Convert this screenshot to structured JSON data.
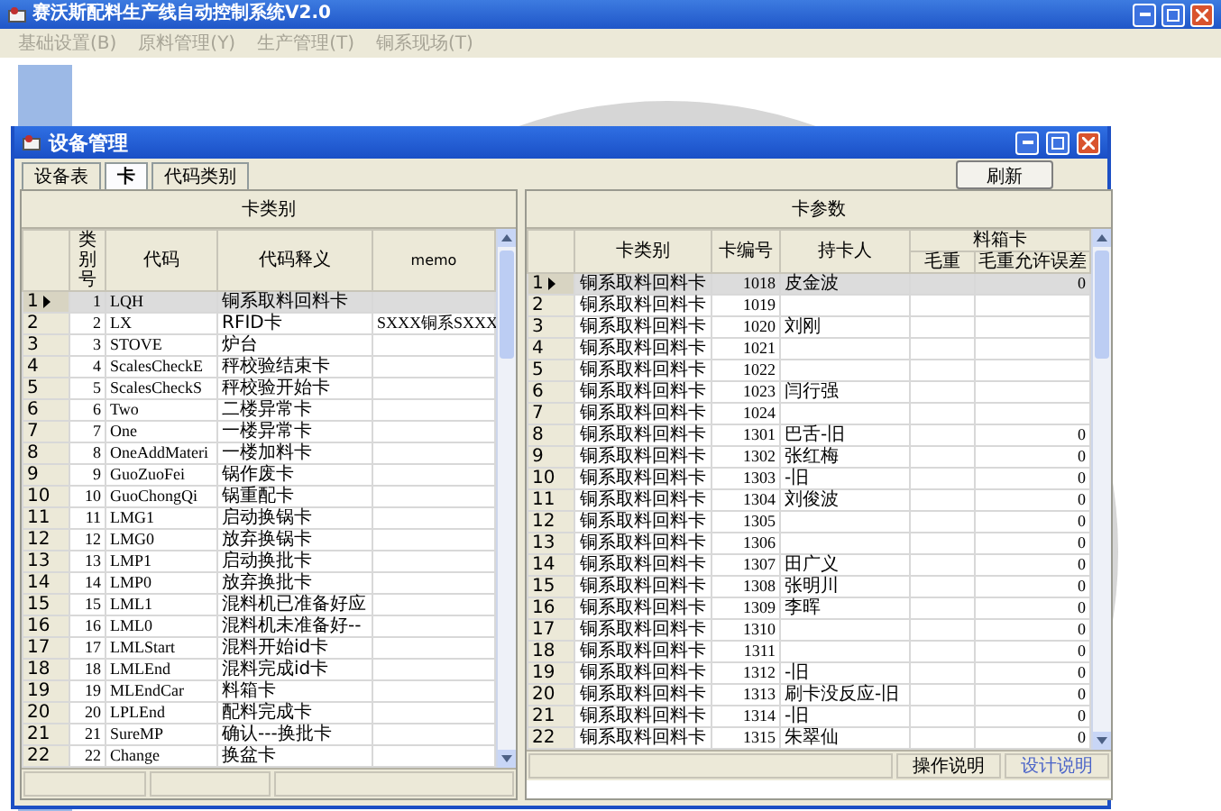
{
  "app": {
    "title": "赛沃斯配料生产线自动控制系统V2.0"
  },
  "menu": [
    {
      "label": "基础设置(B)",
      "disabled": true
    },
    {
      "label": "原料管理(Y)",
      "disabled": true
    },
    {
      "label": "生产管理(T)",
      "disabled": true
    },
    {
      "label": "铜系现场(T)",
      "disabled": true
    }
  ],
  "dialog": {
    "title": "设备管理",
    "tabs": [
      {
        "label": "设备表",
        "selected": false
      },
      {
        "label": "卡",
        "selected": true
      },
      {
        "label": "代码类别",
        "selected": false
      }
    ],
    "refresh_button": "刷新",
    "left_panel": {
      "title": "卡类别",
      "columns": [
        "类别号",
        "代码",
        "代码释义",
        "memo"
      ],
      "rows": [
        {
          "index": "1",
          "selected": true,
          "id": "1",
          "code": "LQH",
          "description": "铜系取料回料卡"
        },
        {
          "index": "2",
          "selected": false,
          "id": "2",
          "code": "LX",
          "description": "RFID卡",
          "memo": "SXXX铜系SXXX"
        },
        {
          "index": "3",
          "selected": false,
          "id": "3",
          "code": "STOVE",
          "description": "炉台"
        },
        {
          "index": "4",
          "selected": false,
          "id": "4",
          "code": "ScalesCheckE",
          "description": "秤校验结束卡"
        },
        {
          "index": "5",
          "selected": false,
          "id": "5",
          "code": "ScalesCheckS",
          "description": "秤校验开始卡"
        },
        {
          "index": "6",
          "selected": false,
          "id": "6",
          "code": "Two",
          "description": "二楼异常卡"
        },
        {
          "index": "7",
          "selected": false,
          "id": "7",
          "code": "One",
          "description": "一楼异常卡"
        },
        {
          "index": "8",
          "selected": false,
          "id": "8",
          "code": "OneAddMateri",
          "description": "一楼加料卡"
        },
        {
          "index": "9",
          "selected": false,
          "id": "9",
          "code": "GuoZuoFei",
          "description": "锅作废卡"
        },
        {
          "index": "10",
          "selected": false,
          "id": "10",
          "code": "GuoChongQi",
          "description": "锅重配卡"
        },
        {
          "index": "11",
          "selected": false,
          "id": "11",
          "code": "LMG1",
          "description": "启动换锅卡"
        },
        {
          "index": "12",
          "selected": false,
          "id": "12",
          "code": "LMG0",
          "description": "放弃换锅卡"
        },
        {
          "index": "13",
          "selected": false,
          "id": "13",
          "code": "LMP1",
          "description": "启动换批卡"
        },
        {
          "index": "14",
          "selected": false,
          "id": "14",
          "code": "LMP0",
          "description": "放弃换批卡"
        },
        {
          "index": "15",
          "selected": false,
          "id": "15",
          "code": "LML1",
          "description": "混料机已准备好应"
        },
        {
          "index": "16",
          "selected": false,
          "id": "16",
          "code": "LML0",
          "description": "混料机未准备好--"
        },
        {
          "index": "17",
          "selected": false,
          "id": "17",
          "code": "LMLStart",
          "description": "混料开始id卡"
        },
        {
          "index": "18",
          "selected": false,
          "id": "18",
          "code": "LMLEnd",
          "description": "混料完成id卡"
        },
        {
          "index": "19",
          "selected": false,
          "id": "19",
          "code": "MLEndCar",
          "description": "料箱卡"
        },
        {
          "index": "20",
          "selected": false,
          "id": "20",
          "code": "LPLEnd",
          "description": "配料完成卡"
        },
        {
          "index": "21",
          "selected": false,
          "id": "21",
          "code": "SureMP",
          "description": "确认---换批卡"
        },
        {
          "index": "22",
          "selected": false,
          "id": "22",
          "code": "Change",
          "description": "换盆卡"
        }
      ]
    },
    "right_panel": {
      "title": "卡参数",
      "columns": {
        "card_type": "卡类别",
        "card_no": "卡编号",
        "holder": "持卡人",
        "group": "料箱卡",
        "gross_weight": "毛重",
        "tolerance": "毛重允许误差"
      },
      "rows": [
        {
          "index": "1",
          "selected": true,
          "card_type": "铜系取料回料卡",
          "card_no": "1018",
          "holder": "皮金波",
          "tolerance": "0"
        },
        {
          "index": "2",
          "selected": false,
          "card_type": "铜系取料回料卡",
          "card_no": "1019"
        },
        {
          "index": "3",
          "selected": false,
          "card_type": "铜系取料回料卡",
          "card_no": "1020",
          "holder": "刘刚"
        },
        {
          "index": "4",
          "selected": false,
          "card_type": "铜系取料回料卡",
          "card_no": "1021"
        },
        {
          "index": "5",
          "selected": false,
          "card_type": "铜系取料回料卡",
          "card_no": "1022"
        },
        {
          "index": "6",
          "selected": false,
          "card_type": "铜系取料回料卡",
          "card_no": "1023",
          "holder": "闫行强"
        },
        {
          "index": "7",
          "selected": false,
          "card_type": "铜系取料回料卡",
          "card_no": "1024"
        },
        {
          "index": "8",
          "selected": false,
          "card_type": "铜系取料回料卡",
          "card_no": "1301",
          "holder": "巴舌-旧",
          "tolerance": "0"
        },
        {
          "index": "9",
          "selected": false,
          "card_type": "铜系取料回料卡",
          "card_no": "1302",
          "holder": "张红梅",
          "tolerance": "0"
        },
        {
          "index": "10",
          "selected": false,
          "card_type": "铜系取料回料卡",
          "card_no": "1303",
          "holder": "-旧",
          "tolerance": "0"
        },
        {
          "index": "11",
          "selected": false,
          "card_type": "铜系取料回料卡",
          "card_no": "1304",
          "holder": "刘俊波",
          "tolerance": "0"
        },
        {
          "index": "12",
          "selected": false,
          "card_type": "铜系取料回料卡",
          "card_no": "1305",
          "tolerance": "0"
        },
        {
          "index": "13",
          "selected": false,
          "card_type": "铜系取料回料卡",
          "card_no": "1306",
          "tolerance": "0"
        },
        {
          "index": "14",
          "selected": false,
          "card_type": "铜系取料回料卡",
          "card_no": "1307",
          "holder": "田广义",
          "tolerance": "0"
        },
        {
          "index": "15",
          "selected": false,
          "card_type": "铜系取料回料卡",
          "card_no": "1308",
          "holder": "张明川",
          "tolerance": "0"
        },
        {
          "index": "16",
          "selected": false,
          "card_type": "铜系取料回料卡",
          "card_no": "1309",
          "holder": "李晖",
          "tolerance": "0"
        },
        {
          "index": "17",
          "selected": false,
          "card_type": "铜系取料回料卡",
          "card_no": "1310",
          "tolerance": "0"
        },
        {
          "index": "18",
          "selected": false,
          "card_type": "铜系取料回料卡",
          "card_no": "1311",
          "tolerance": "0"
        },
        {
          "index": "19",
          "selected": false,
          "card_type": "铜系取料回料卡",
          "card_no": "1312",
          "holder": "-旧",
          "tolerance": "0"
        },
        {
          "index": "20",
          "selected": false,
          "card_type": "铜系取料回料卡",
          "card_no": "1313",
          "holder": "刷卡没反应-旧",
          "tolerance": "0"
        },
        {
          "index": "21",
          "selected": false,
          "card_type": "铜系取料回料卡",
          "card_no": "1314",
          "holder": "-旧",
          "tolerance": "0"
        },
        {
          "index": "22",
          "selected": false,
          "card_type": "铜系取料回料卡",
          "card_no": "1315",
          "holder": "朱翠仙",
          "tolerance": "0"
        }
      ]
    },
    "status_bar": [
      {
        "label": "操作说明",
        "kind": "text"
      },
      {
        "label": "设计说明",
        "kind": "link"
      }
    ]
  }
}
